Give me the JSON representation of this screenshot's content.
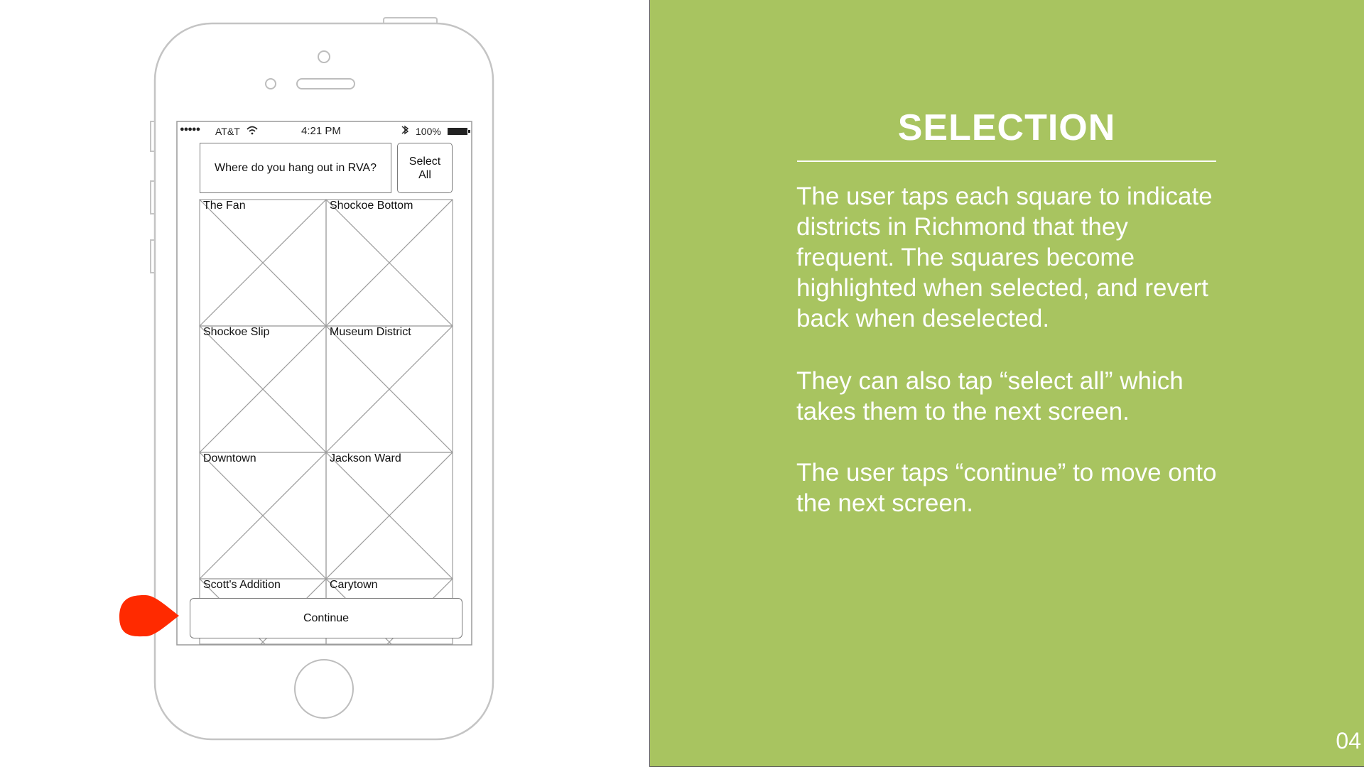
{
  "status_bar": {
    "signal": "●●●●●",
    "carrier": "AT&T",
    "time": "4:21 PM",
    "battery": "100%",
    "icons": [
      "wifi-icon",
      "bluetooth-icon",
      "battery-icon"
    ]
  },
  "header": {
    "prompt": "Where do you hang out in RVA?",
    "select_all_line1": "Select",
    "select_all_line2": "All"
  },
  "grid": {
    "cells": [
      {
        "label": "The Fan"
      },
      {
        "label": "Shockoe Bottom"
      },
      {
        "label": "Shockoe Slip"
      },
      {
        "label": "Museum District"
      },
      {
        "label": "Downtown"
      },
      {
        "label": "Jackson Ward"
      },
      {
        "label": "Scott's Addition"
      },
      {
        "label": "Carytown"
      }
    ]
  },
  "footer": {
    "continue_label": "Continue"
  },
  "annotation": {
    "marker_color": "#ff2a00"
  },
  "panel": {
    "title": "SELECTION",
    "paragraphs": [
      "The user taps each square to indicate districts in Richmond that they frequent. The squares become highlighted when selected, and revert back when deselected.",
      "They can also tap “select all” which takes them to the next screen.",
      "The user taps “continue” to move onto the next screen."
    ],
    "page_number": "04",
    "background_color": "#a8c460"
  }
}
